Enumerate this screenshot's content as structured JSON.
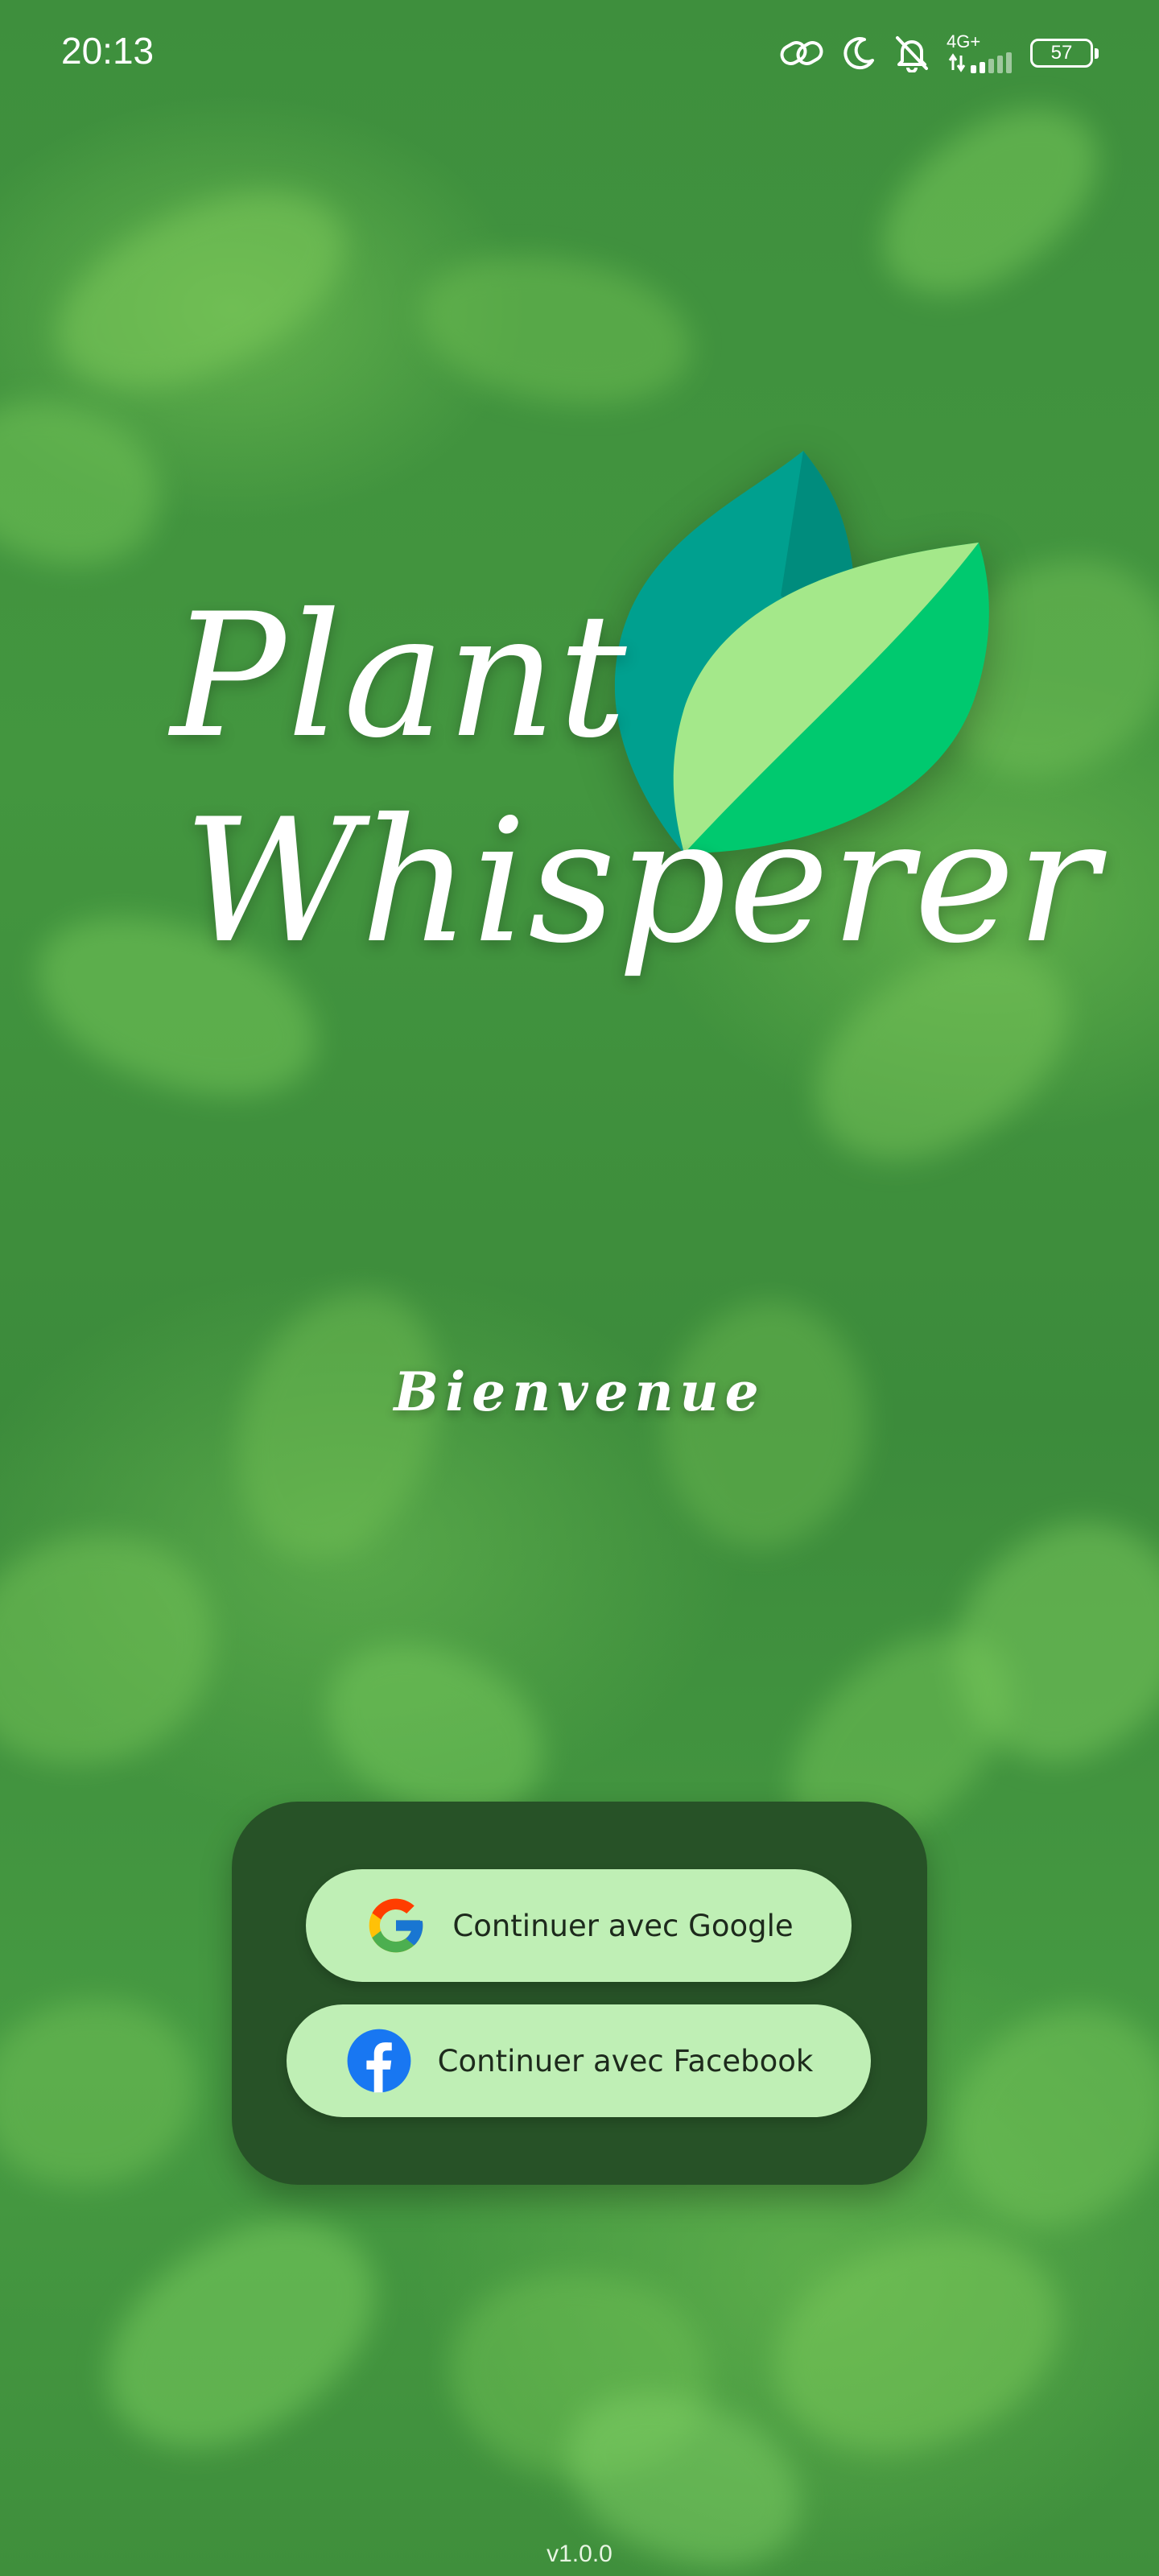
{
  "status_bar": {
    "time": "20:13",
    "network": "4G+",
    "battery": "57",
    "icons": [
      "link-icon",
      "moon-icon",
      "bell-off-icon",
      "signal-icon",
      "battery-icon"
    ]
  },
  "app": {
    "title_line1": "Plant",
    "title_line2": "Whisperer",
    "welcome": "Bienvenue",
    "logo_icon": "leaf-logo-icon"
  },
  "auth": {
    "google_label": "Continuer avec Google",
    "facebook_label": "Continuer avec Facebook",
    "google_icon": "google-icon",
    "facebook_icon": "facebook-icon"
  },
  "footer": {
    "version": "v1.0.0"
  },
  "colors": {
    "background": "#3f9441",
    "card": "#275227",
    "button": "#bfefb5",
    "button_text": "#1d2a1c",
    "leaf_dark": "#00a08f",
    "leaf_light": "#a4e88a",
    "leaf_bright": "#00c96f",
    "facebook_blue": "#1877f2"
  }
}
